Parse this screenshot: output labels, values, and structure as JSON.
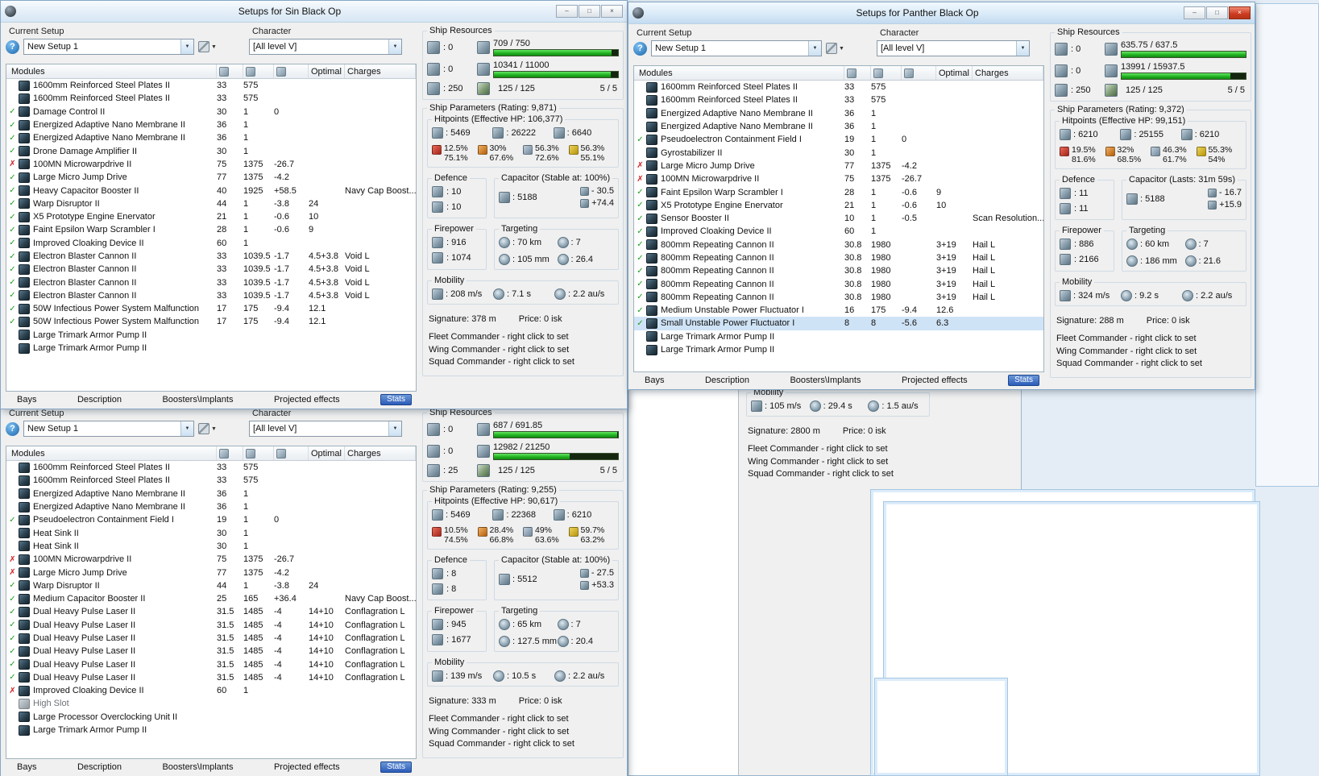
{
  "shared": {
    "labels": {
      "current_setup": "Current Setup",
      "character": "Character",
      "ship_resources": "Ship Resources",
      "modules": "Modules",
      "optimal": "Optimal",
      "charges": "Charges",
      "defence": "Defence",
      "firepower": "Firepower",
      "targeting": "Targeting",
      "mobility": "Mobility",
      "price": "Price: 0 isk"
    },
    "tabs": [
      "Bays",
      "Description",
      "Boosters\\Implants",
      "Projected effects",
      "Stats"
    ],
    "commanders": [
      "Fleet Commander - right click to set",
      "Wing Commander - right click to set",
      "Squad Commander - right click to set"
    ],
    "icons": {
      "help": "?",
      "dropdown_arrow": "▼",
      "tools_arrow": "▼",
      "minimize": "–",
      "maximize": "□",
      "close": "×",
      "check": "✓",
      "cross": "✗"
    }
  },
  "windows": {
    "sin": {
      "title": "Setups for Sin Black Op",
      "setup": "New Setup 1",
      "character": "[All level V]",
      "res": {
        "turrets": ": 0",
        "launchers": ": 0",
        "calibration": ": 250",
        "cpu": "709 / 750",
        "cpu_pct": 94.5,
        "pg": "10341 / 11000",
        "pg_pct": 94,
        "drones": "125 / 125",
        "slots": "5 / 5"
      },
      "stats": {
        "params_title": "Ship Parameters (Rating: 9,871)",
        "hp_title": "Hitpoints (Effective HP: 106,377)",
        "hp": [
          ": 5469",
          ": 26222",
          ": 6640"
        ],
        "resists": [
          [
            "12.5%",
            "75.1%"
          ],
          [
            "30%",
            "67.6%"
          ],
          [
            "56.3%",
            "72.6%"
          ],
          [
            "56.3%",
            "55.1%"
          ]
        ],
        "defence": [
          ": 10",
          ": 10"
        ],
        "cap_title": "Capacitor (Stable at: 100%)",
        "cap": [
          ": 5188",
          "- 30.5",
          "+74.4"
        ],
        "firepower": [
          ": 916",
          ": 1074"
        ],
        "targeting": [
          ": 70 km",
          ": 7",
          ": 105 mm",
          ": 26.4"
        ],
        "mobility": [
          ": 208 m/s",
          ": 7.1 s",
          ": 2.2 au/s"
        ],
        "signature": "Signature: 378 m"
      },
      "modules": [
        {
          "s": "none",
          "name": "1600mm Reinforced Steel Plates II",
          "v1": "33",
          "v2": "575"
        },
        {
          "s": "none",
          "name": "1600mm Reinforced Steel Plates II",
          "v1": "33",
          "v2": "575"
        },
        {
          "s": "ok",
          "name": "Damage Control II",
          "v1": "30",
          "v2": "1",
          "v3": "0"
        },
        {
          "s": "ok",
          "name": "Energized Adaptive Nano Membrane II",
          "v1": "36",
          "v2": "1"
        },
        {
          "s": "ok",
          "name": "Energized Adaptive Nano Membrane II",
          "v1": "36",
          "v2": "1"
        },
        {
          "s": "ok",
          "name": "Drone Damage Amplifier II",
          "v1": "30",
          "v2": "1"
        },
        {
          "s": "err",
          "name": "100MN Microwarpdrive II",
          "v1": "75",
          "v2": "1375",
          "v3": "-26.7"
        },
        {
          "s": "ok",
          "name": "Large Micro Jump Drive",
          "v1": "77",
          "v2": "1375",
          "v3": "-4.2"
        },
        {
          "s": "ok",
          "name": "Heavy Capacitor Booster II",
          "v1": "40",
          "v2": "1925",
          "v3": "+58.5",
          "chg": "Navy Cap Boost..."
        },
        {
          "s": "ok",
          "name": "Warp Disruptor II",
          "v1": "44",
          "v2": "1",
          "v3": "-3.8",
          "opt": "24"
        },
        {
          "s": "ok",
          "name": "X5 Prototype Engine Enervator",
          "v1": "21",
          "v2": "1",
          "v3": "-0.6",
          "opt": "10"
        },
        {
          "s": "ok",
          "name": "Faint Epsilon Warp Scrambler I",
          "v1": "28",
          "v2": "1",
          "v3": "-0.6",
          "opt": "9"
        },
        {
          "s": "ok",
          "name": "Improved Cloaking Device II",
          "v1": "60",
          "v2": "1"
        },
        {
          "s": "ok",
          "name": "Electron Blaster Cannon II",
          "v1": "33",
          "v2": "1039.5",
          "v3": "-1.7",
          "opt": "4.5+3.8",
          "chg": "Void L"
        },
        {
          "s": "ok",
          "name": "Electron Blaster Cannon II",
          "v1": "33",
          "v2": "1039.5",
          "v3": "-1.7",
          "opt": "4.5+3.8",
          "chg": "Void L"
        },
        {
          "s": "ok",
          "name": "Electron Blaster Cannon II",
          "v1": "33",
          "v2": "1039.5",
          "v3": "-1.7",
          "opt": "4.5+3.8",
          "chg": "Void L"
        },
        {
          "s": "ok",
          "name": "Electron Blaster Cannon II",
          "v1": "33",
          "v2": "1039.5",
          "v3": "-1.7",
          "opt": "4.5+3.8",
          "chg": "Void L"
        },
        {
          "s": "ok",
          "name": "50W Infectious Power System Malfunction",
          "v1": "17",
          "v2": "175",
          "v3": "-9.4",
          "opt": "12.1"
        },
        {
          "s": "ok",
          "name": "50W Infectious Power System Malfunction",
          "v1": "17",
          "v2": "175",
          "v3": "-9.4",
          "opt": "12.1"
        },
        {
          "s": "none",
          "name": "Large Trimark Armor Pump II"
        },
        {
          "s": "none",
          "name": "Large Trimark Armor Pump II"
        }
      ]
    },
    "sin2": {
      "title": "",
      "setup": "New Setup 1",
      "character": "[All level V]",
      "res": {
        "turrets": ": 0",
        "launchers": ": 0",
        "calibration": ": 25",
        "cpu": "687 / 691.85",
        "cpu_pct": 99.3,
        "pg": "12982 / 21250",
        "pg_pct": 61.1,
        "drones": "125 / 125",
        "slots": "5 / 5"
      },
      "stats": {
        "params_title": "Ship Parameters (Rating: 9,255)",
        "hp_title": "Hitpoints (Effective HP: 90,617)",
        "hp": [
          ": 5469",
          ": 22368",
          ": 6210"
        ],
        "resists": [
          [
            "10.5%",
            "74.5%"
          ],
          [
            "28.4%",
            "66.8%"
          ],
          [
            "49%",
            "63.6%"
          ],
          [
            "59.7%",
            "63.2%"
          ]
        ],
        "defence": [
          ": 8",
          ": 8"
        ],
        "cap_title": "Capacitor (Stable at: 100%)",
        "cap": [
          ": 5512",
          "- 27.5",
          "+53.3"
        ],
        "firepower": [
          ": 945",
          ": 1677"
        ],
        "targeting": [
          ": 65 km",
          ": 7",
          ": 127.5 mm",
          ": 20.4"
        ],
        "mobility": [
          ": 139 m/s",
          ": 10.5 s",
          ": 2.2 au/s"
        ],
        "signature": "Signature: 333 m"
      },
      "modules": [
        {
          "s": "none",
          "name": "1600mm Reinforced Steel Plates II",
          "v1": "33",
          "v2": "575"
        },
        {
          "s": "none",
          "name": "1600mm Reinforced Steel Plates II",
          "v1": "33",
          "v2": "575"
        },
        {
          "s": "none",
          "name": "Energized Adaptive Nano Membrane II",
          "v1": "36",
          "v2": "1"
        },
        {
          "s": "none",
          "name": "Energized Adaptive Nano Membrane II",
          "v1": "36",
          "v2": "1"
        },
        {
          "s": "ok",
          "name": "Pseudoelectron Containment Field I",
          "v1": "19",
          "v2": "1",
          "v3": "0"
        },
        {
          "s": "none",
          "name": "Heat Sink II",
          "v1": "30",
          "v2": "1"
        },
        {
          "s": "none",
          "name": "Heat Sink II",
          "v1": "30",
          "v2": "1"
        },
        {
          "s": "err",
          "name": "100MN Microwarpdrive II",
          "v1": "75",
          "v2": "1375",
          "v3": "-26.7"
        },
        {
          "s": "err",
          "name": "Large Micro Jump Drive",
          "v1": "77",
          "v2": "1375",
          "v3": "-4.2"
        },
        {
          "s": "ok",
          "name": "Warp Disruptor II",
          "v1": "44",
          "v2": "1",
          "v3": "-3.8",
          "opt": "24"
        },
        {
          "s": "ok",
          "name": "Medium Capacitor Booster II",
          "v1": "25",
          "v2": "165",
          "v3": "+36.4",
          "chg": "Navy Cap Boost..."
        },
        {
          "s": "ok",
          "name": "Dual Heavy Pulse Laser II",
          "v1": "31.5",
          "v2": "1485",
          "v3": "-4",
          "opt": "14+10",
          "chg": "Conflagration L"
        },
        {
          "s": "ok",
          "name": "Dual Heavy Pulse Laser II",
          "v1": "31.5",
          "v2": "1485",
          "v3": "-4",
          "opt": "14+10",
          "chg": "Conflagration L"
        },
        {
          "s": "ok",
          "name": "Dual Heavy Pulse Laser II",
          "v1": "31.5",
          "v2": "1485",
          "v3": "-4",
          "opt": "14+10",
          "chg": "Conflagration L"
        },
        {
          "s": "ok",
          "name": "Dual Heavy Pulse Laser II",
          "v1": "31.5",
          "v2": "1485",
          "v3": "-4",
          "opt": "14+10",
          "chg": "Conflagration L"
        },
        {
          "s": "ok",
          "name": "Dual Heavy Pulse Laser II",
          "v1": "31.5",
          "v2": "1485",
          "v3": "-4",
          "opt": "14+10",
          "chg": "Conflagration L"
        },
        {
          "s": "ok",
          "name": "Dual Heavy Pulse Laser II",
          "v1": "31.5",
          "v2": "1485",
          "v3": "-4",
          "opt": "14+10",
          "chg": "Conflagration L"
        },
        {
          "s": "err",
          "name": "Improved Cloaking Device II",
          "v1": "60",
          "v2": "1"
        },
        {
          "s": "none",
          "name": "High Slot",
          "empty": true
        },
        {
          "s": "none",
          "name": "Large Processor Overclocking Unit II"
        },
        {
          "s": "none",
          "name": "Large Trimark Armor Pump II"
        }
      ]
    },
    "panther": {
      "title": "Setups for Panther Black Op",
      "setup": "New Setup 1",
      "character": "[All level V]",
      "res": {
        "turrets": ": 0",
        "launchers": ": 0",
        "calibration": ": 250",
        "cpu": "635.75 / 637.5",
        "cpu_pct": 99.7,
        "pg": "13991 / 15937.5",
        "pg_pct": 87.8,
        "drones": "125 / 125",
        "slots": "5 / 5"
      },
      "stats": {
        "params_title": "Ship Parameters (Rating: 9,372)",
        "hp_title": "Hitpoints (Effective HP: 99,151)",
        "hp": [
          ": 6210",
          ": 25155",
          ": 6210"
        ],
        "resists": [
          [
            "19.5%",
            "81.6%"
          ],
          [
            "32%",
            "68.5%"
          ],
          [
            "46.3%",
            "61.7%"
          ],
          [
            "55.3%",
            "54%"
          ]
        ],
        "defence": [
          ": 11",
          ": 11"
        ],
        "cap_title": "Capacitor (Lasts: 31m 59s)",
        "cap": [
          ": 5188",
          "- 16.7",
          "+15.9"
        ],
        "firepower": [
          ": 886",
          ": 2166"
        ],
        "targeting": [
          ": 60 km",
          ": 7",
          ": 186 mm",
          ": 21.6"
        ],
        "mobility": [
          ": 324 m/s",
          ": 9.2 s",
          ": 2.2 au/s"
        ],
        "signature": "Signature: 288 m"
      },
      "modules": [
        {
          "s": "none",
          "name": "1600mm Reinforced Steel Plates II",
          "v1": "33",
          "v2": "575"
        },
        {
          "s": "none",
          "name": "1600mm Reinforced Steel Plates II",
          "v1": "33",
          "v2": "575"
        },
        {
          "s": "none",
          "name": "Energized Adaptive Nano Membrane II",
          "v1": "36",
          "v2": "1"
        },
        {
          "s": "none",
          "name": "Energized Adaptive Nano Membrane II",
          "v1": "36",
          "v2": "1"
        },
        {
          "s": "ok",
          "name": "Pseudoelectron Containment Field I",
          "v1": "19",
          "v2": "1",
          "v3": "0"
        },
        {
          "s": "none",
          "name": "Gyrostabilizer II",
          "v1": "30",
          "v2": "1"
        },
        {
          "s": "err",
          "name": "Large Micro Jump Drive",
          "v1": "77",
          "v2": "1375",
          "v3": "-4.2"
        },
        {
          "s": "err",
          "name": "100MN Microwarpdrive II",
          "v1": "75",
          "v2": "1375",
          "v3": "-26.7"
        },
        {
          "s": "ok",
          "name": "Faint Epsilon Warp Scrambler I",
          "v1": "28",
          "v2": "1",
          "v3": "-0.6",
          "opt": "9"
        },
        {
          "s": "ok",
          "name": "X5 Prototype Engine Enervator",
          "v1": "21",
          "v2": "1",
          "v3": "-0.6",
          "opt": "10"
        },
        {
          "s": "ok",
          "name": "Sensor Booster II",
          "v1": "10",
          "v2": "1",
          "v3": "-0.5",
          "chg": "Scan Resolution..."
        },
        {
          "s": "ok",
          "name": "Improved Cloaking Device II",
          "v1": "60",
          "v2": "1"
        },
        {
          "s": "ok",
          "name": "800mm Repeating Cannon II",
          "v1": "30.8",
          "v2": "1980",
          "opt": "3+19",
          "chg": "Hail L"
        },
        {
          "s": "ok",
          "name": "800mm Repeating Cannon II",
          "v1": "30.8",
          "v2": "1980",
          "opt": "3+19",
          "chg": "Hail L"
        },
        {
          "s": "ok",
          "name": "800mm Repeating Cannon II",
          "v1": "30.8",
          "v2": "1980",
          "opt": "3+19",
          "chg": "Hail L"
        },
        {
          "s": "ok",
          "name": "800mm Repeating Cannon II",
          "v1": "30.8",
          "v2": "1980",
          "opt": "3+19",
          "chg": "Hail L"
        },
        {
          "s": "ok",
          "name": "800mm Repeating Cannon II",
          "v1": "30.8",
          "v2": "1980",
          "opt": "3+19",
          "chg": "Hail L"
        },
        {
          "s": "ok",
          "name": "Medium Unstable Power Fluctuator I",
          "v1": "16",
          "v2": "175",
          "v3": "-9.4",
          "opt": "12.6"
        },
        {
          "s": "ok",
          "name": "Small Unstable Power Fluctuator I",
          "v1": "8",
          "v2": "8",
          "v3": "-5.6",
          "opt": "6.3",
          "selected": true
        },
        {
          "s": "none",
          "name": "Large Trimark Armor Pump II"
        },
        {
          "s": "none",
          "name": "Large Trimark Armor Pump II"
        }
      ]
    },
    "bg": {
      "mobility": [
        ": 105 m/s",
        ": 29.4 s",
        ": 1.5 au/s"
      ],
      "signature": "Signature: 2800 m"
    }
  }
}
